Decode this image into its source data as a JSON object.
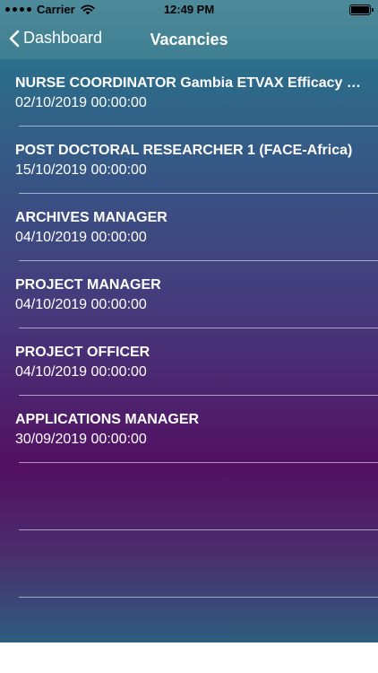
{
  "status": {
    "carrier": "Carrier",
    "time": "12:49 PM"
  },
  "nav": {
    "back_label": "Dashboard",
    "title": "Vacancies"
  },
  "vacancies": [
    {
      "title": "NURSE COORDINATOR Gambia ETVAX Efficacy Trial",
      "date": "02/10/2019 00:00:00"
    },
    {
      "title": "POST DOCTORAL RESEARCHER 1 (FACE-Africa)",
      "date": "15/10/2019 00:00:00"
    },
    {
      "title": "ARCHIVES MANAGER",
      "date": "04/10/2019 00:00:00"
    },
    {
      "title": "PROJECT MANAGER",
      "date": "04/10/2019 00:00:00"
    },
    {
      "title": "PROJECT OFFICER",
      "date": "04/10/2019 00:00:00"
    },
    {
      "title": "APPLICATIONS MANAGER",
      "date": "30/09/2019 00:00:00"
    }
  ],
  "colors": {
    "header": "#4d8a9a",
    "gradient_top": "#2b6f8b",
    "gradient_mid": "#530f62",
    "text": "#ffffff"
  }
}
